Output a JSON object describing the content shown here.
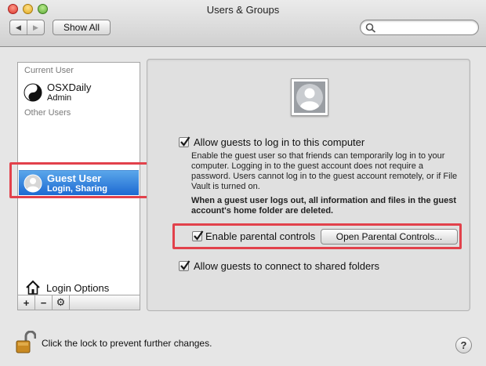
{
  "window": {
    "title": "Users & Groups"
  },
  "toolbar": {
    "back_label": "◀",
    "forward_label": "▶",
    "show_all_label": "Show All",
    "search_value": "",
    "search_placeholder": ""
  },
  "sidebar": {
    "current_user_header": "Current User",
    "current_user": {
      "name": "OSXDaily",
      "role": "Admin"
    },
    "other_users_header": "Other Users",
    "other_users": [
      {
        "name": "Guest User",
        "role": "Login, Sharing",
        "selected": true
      }
    ],
    "login_options_label": "Login Options",
    "tools": {
      "add_label": "+",
      "remove_label": "−",
      "action_label": "⚙"
    }
  },
  "guest_panel": {
    "allow_login_label": "Allow guests to log in to this computer",
    "allow_login_checked": true,
    "allow_login_description": "Enable the guest user so that friends can temporarily log in to your computer. Logging in to the guest account does not require a password. Users cannot log in to the guest account remotely, or if File Vault is turned on.",
    "logout_warning": "When a guest user logs out, all information and files in the guest account's home folder are deleted.",
    "parental_controls_label": "Enable parental controls",
    "parental_controls_checked": true,
    "open_parental_controls_label": "Open Parental Controls...",
    "shared_folders_label": "Allow guests to connect to shared folders",
    "shared_folders_checked": true
  },
  "footer": {
    "lock_text": "Click the lock to prevent further changes.",
    "help_label": "?"
  },
  "colors": {
    "highlight": "#e2414b",
    "selection": "#1d6ad2"
  }
}
